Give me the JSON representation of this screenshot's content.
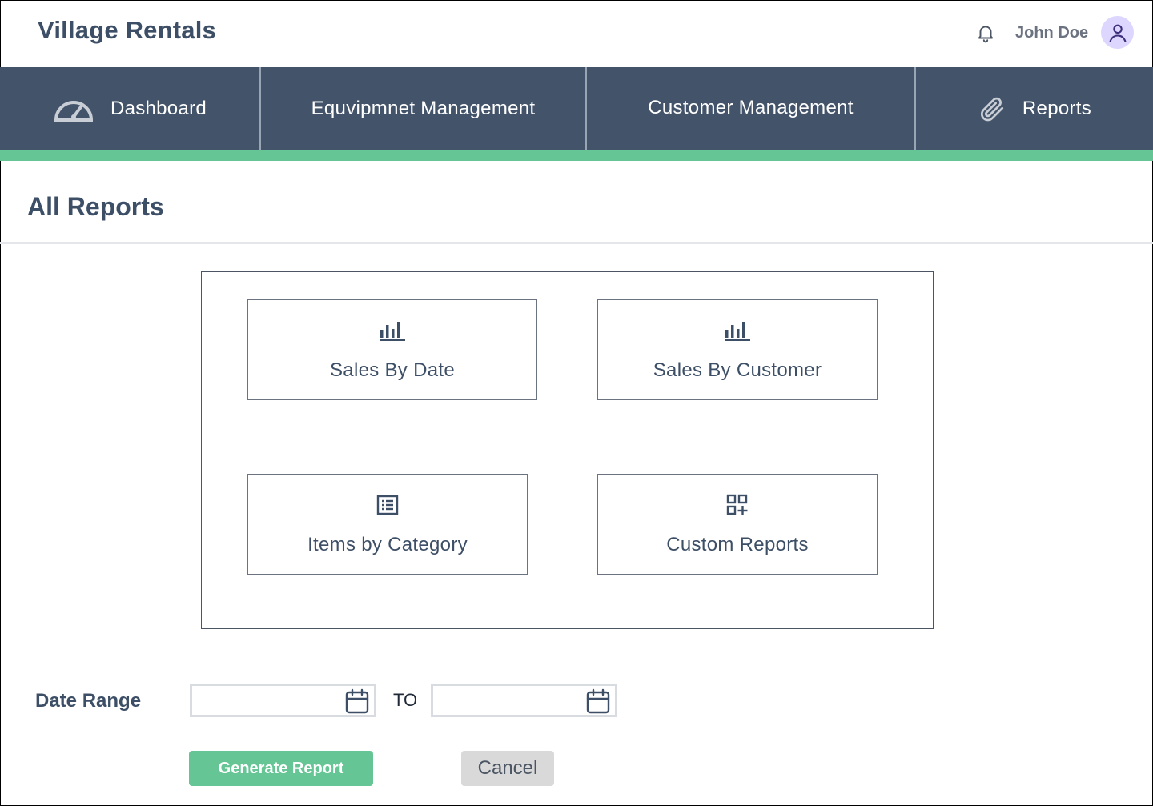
{
  "header": {
    "app_title": "Village Rentals",
    "user_name": "John Doe",
    "bell_icon": "bell-icon",
    "avatar_icon": "user-icon",
    "avatar_color": "#ddd6fe"
  },
  "nav": {
    "items": [
      {
        "label": "Dashboard",
        "icon": "speedometer-icon"
      },
      {
        "label": "Equvipmnet Management"
      },
      {
        "label": "Customer Management"
      },
      {
        "label": "Reports",
        "icon": "paperclip-icon"
      }
    ],
    "background": "#43536a",
    "accent": "#65c594"
  },
  "page": {
    "title": "All Reports"
  },
  "reports": [
    {
      "label": "Sales By Date",
      "icon": "bar-chart-icon"
    },
    {
      "label": "Sales By Customer",
      "icon": "bar-chart-icon"
    },
    {
      "label": "Items by Category",
      "icon": "list-icon"
    },
    {
      "label": "Custom Reports",
      "icon": "grid-plus-icon"
    }
  ],
  "date_range": {
    "label": "Date Range",
    "separator": "TO",
    "start_value": "",
    "end_value": ""
  },
  "actions": {
    "generate_label": "Generate Report",
    "cancel_label": "Cancel",
    "generate_color": "#65c594"
  }
}
